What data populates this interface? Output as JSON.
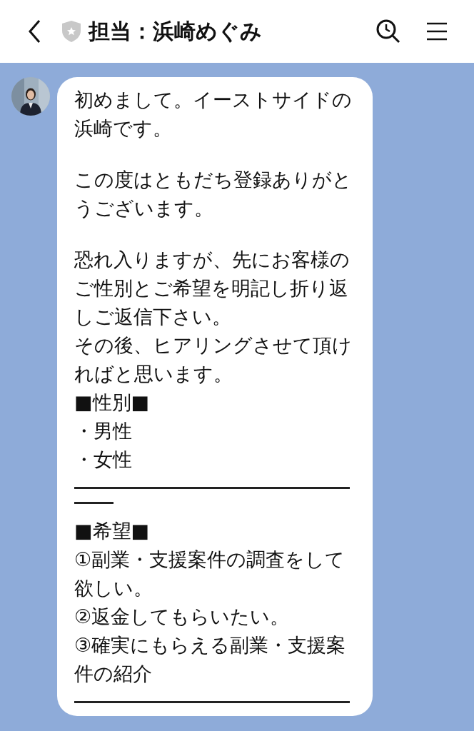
{
  "header": {
    "title": "担当：浜崎めぐみ"
  },
  "message": {
    "blocks": [
      {
        "kind": "text",
        "text": "初めまして。イーストサイドの浜崎です。"
      },
      {
        "kind": "blank"
      },
      {
        "kind": "text",
        "text": "この度はともだち登録ありがとうございます。"
      },
      {
        "kind": "blank"
      },
      {
        "kind": "text",
        "text": "恐れ入りますが、先にお客様のご性別とご希望を明記し折り返しご返信下さい。"
      },
      {
        "kind": "text",
        "text": "その後、ヒアリングさせて頂ければと思います。"
      },
      {
        "kind": "text",
        "text": "■性別■"
      },
      {
        "kind": "text",
        "text": "・男性"
      },
      {
        "kind": "text",
        "text": "・女性"
      },
      {
        "kind": "rule"
      },
      {
        "kind": "stub"
      },
      {
        "kind": "text",
        "text": "■希望■"
      },
      {
        "kind": "text",
        "text": "①副業・支援案件の調査をして欲しい。"
      },
      {
        "kind": "text",
        "text": "②返金してもらいたい。"
      },
      {
        "kind": "text",
        "text": "③確実にもらえる副業・支援案件の紹介"
      },
      {
        "kind": "rule"
      }
    ]
  }
}
